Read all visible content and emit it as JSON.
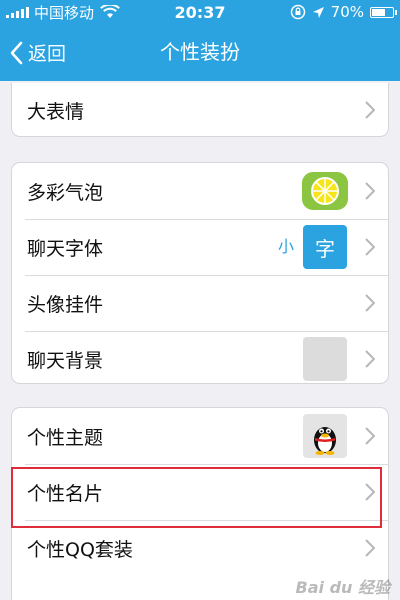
{
  "status_bar": {
    "carrier": "中国移动",
    "time": "20:37",
    "battery": "70%",
    "battery_level": 0.7
  },
  "nav": {
    "back_label": "返回",
    "title": "个性装扮"
  },
  "groups": {
    "first": [
      {
        "label": "大表情"
      }
    ],
    "second": [
      {
        "label": "多彩气泡"
      },
      {
        "label": "聊天字体",
        "preview_small": "小",
        "preview_big": "字"
      },
      {
        "label": "头像挂件"
      },
      {
        "label": "聊天背景"
      }
    ],
    "third": [
      {
        "label": "个性主题"
      },
      {
        "label": "个性名片"
      },
      {
        "label": "个性QQ套装"
      }
    ]
  },
  "watermark": "Bai du 经验",
  "colors": {
    "accent": "#2aa3e0",
    "highlight": "#e02d3c",
    "bubble": "#8cc541"
  }
}
